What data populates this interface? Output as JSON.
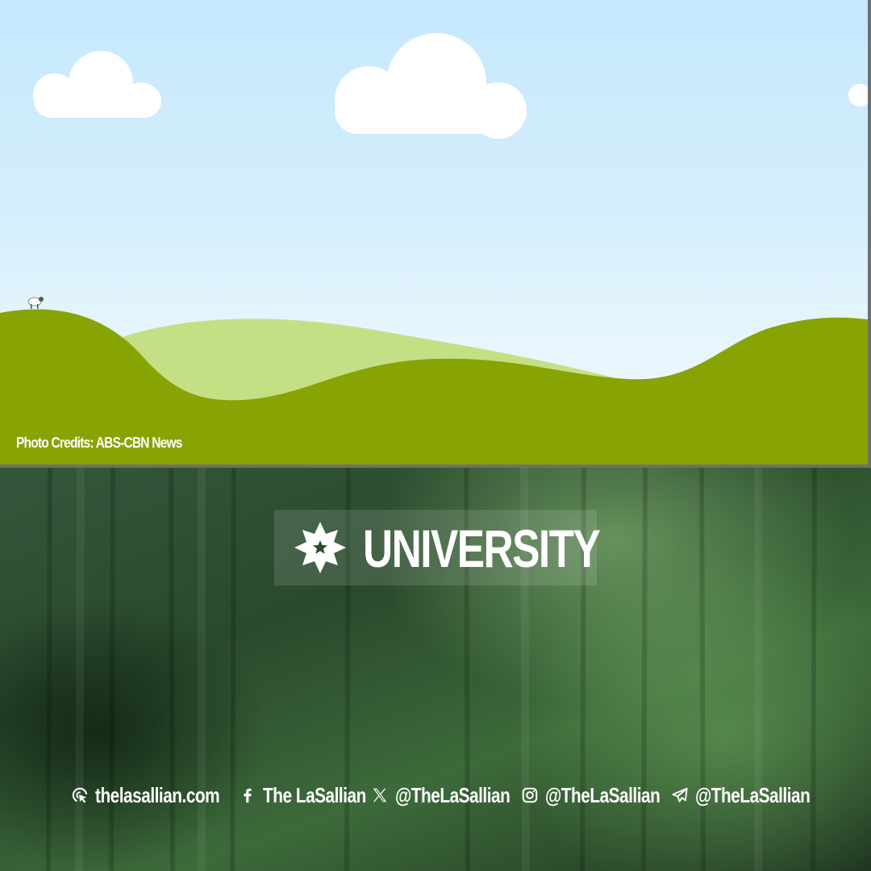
{
  "photo": {
    "credit": "Photo Credits: ABS-CBN News"
  },
  "category": {
    "label": "UNIVERSITY",
    "icon": "star-burst-icon"
  },
  "socials": [
    {
      "icon": "web-cursor-icon",
      "text": "thelasallian.com"
    },
    {
      "icon": "facebook-icon",
      "text": "The LaSallian"
    },
    {
      "icon": "x-icon",
      "text": "@TheLaSallian"
    },
    {
      "icon": "instagram-icon",
      "text": "@TheLaSallian"
    },
    {
      "icon": "telegram-icon",
      "text": "@TheLaSallian"
    }
  ],
  "colors": {
    "sky": "#cdebfc",
    "hill_dark": "#87a404",
    "hill_light": "#c4e085",
    "brand_green": "#2e4a2a",
    "text": "#ffffff"
  }
}
